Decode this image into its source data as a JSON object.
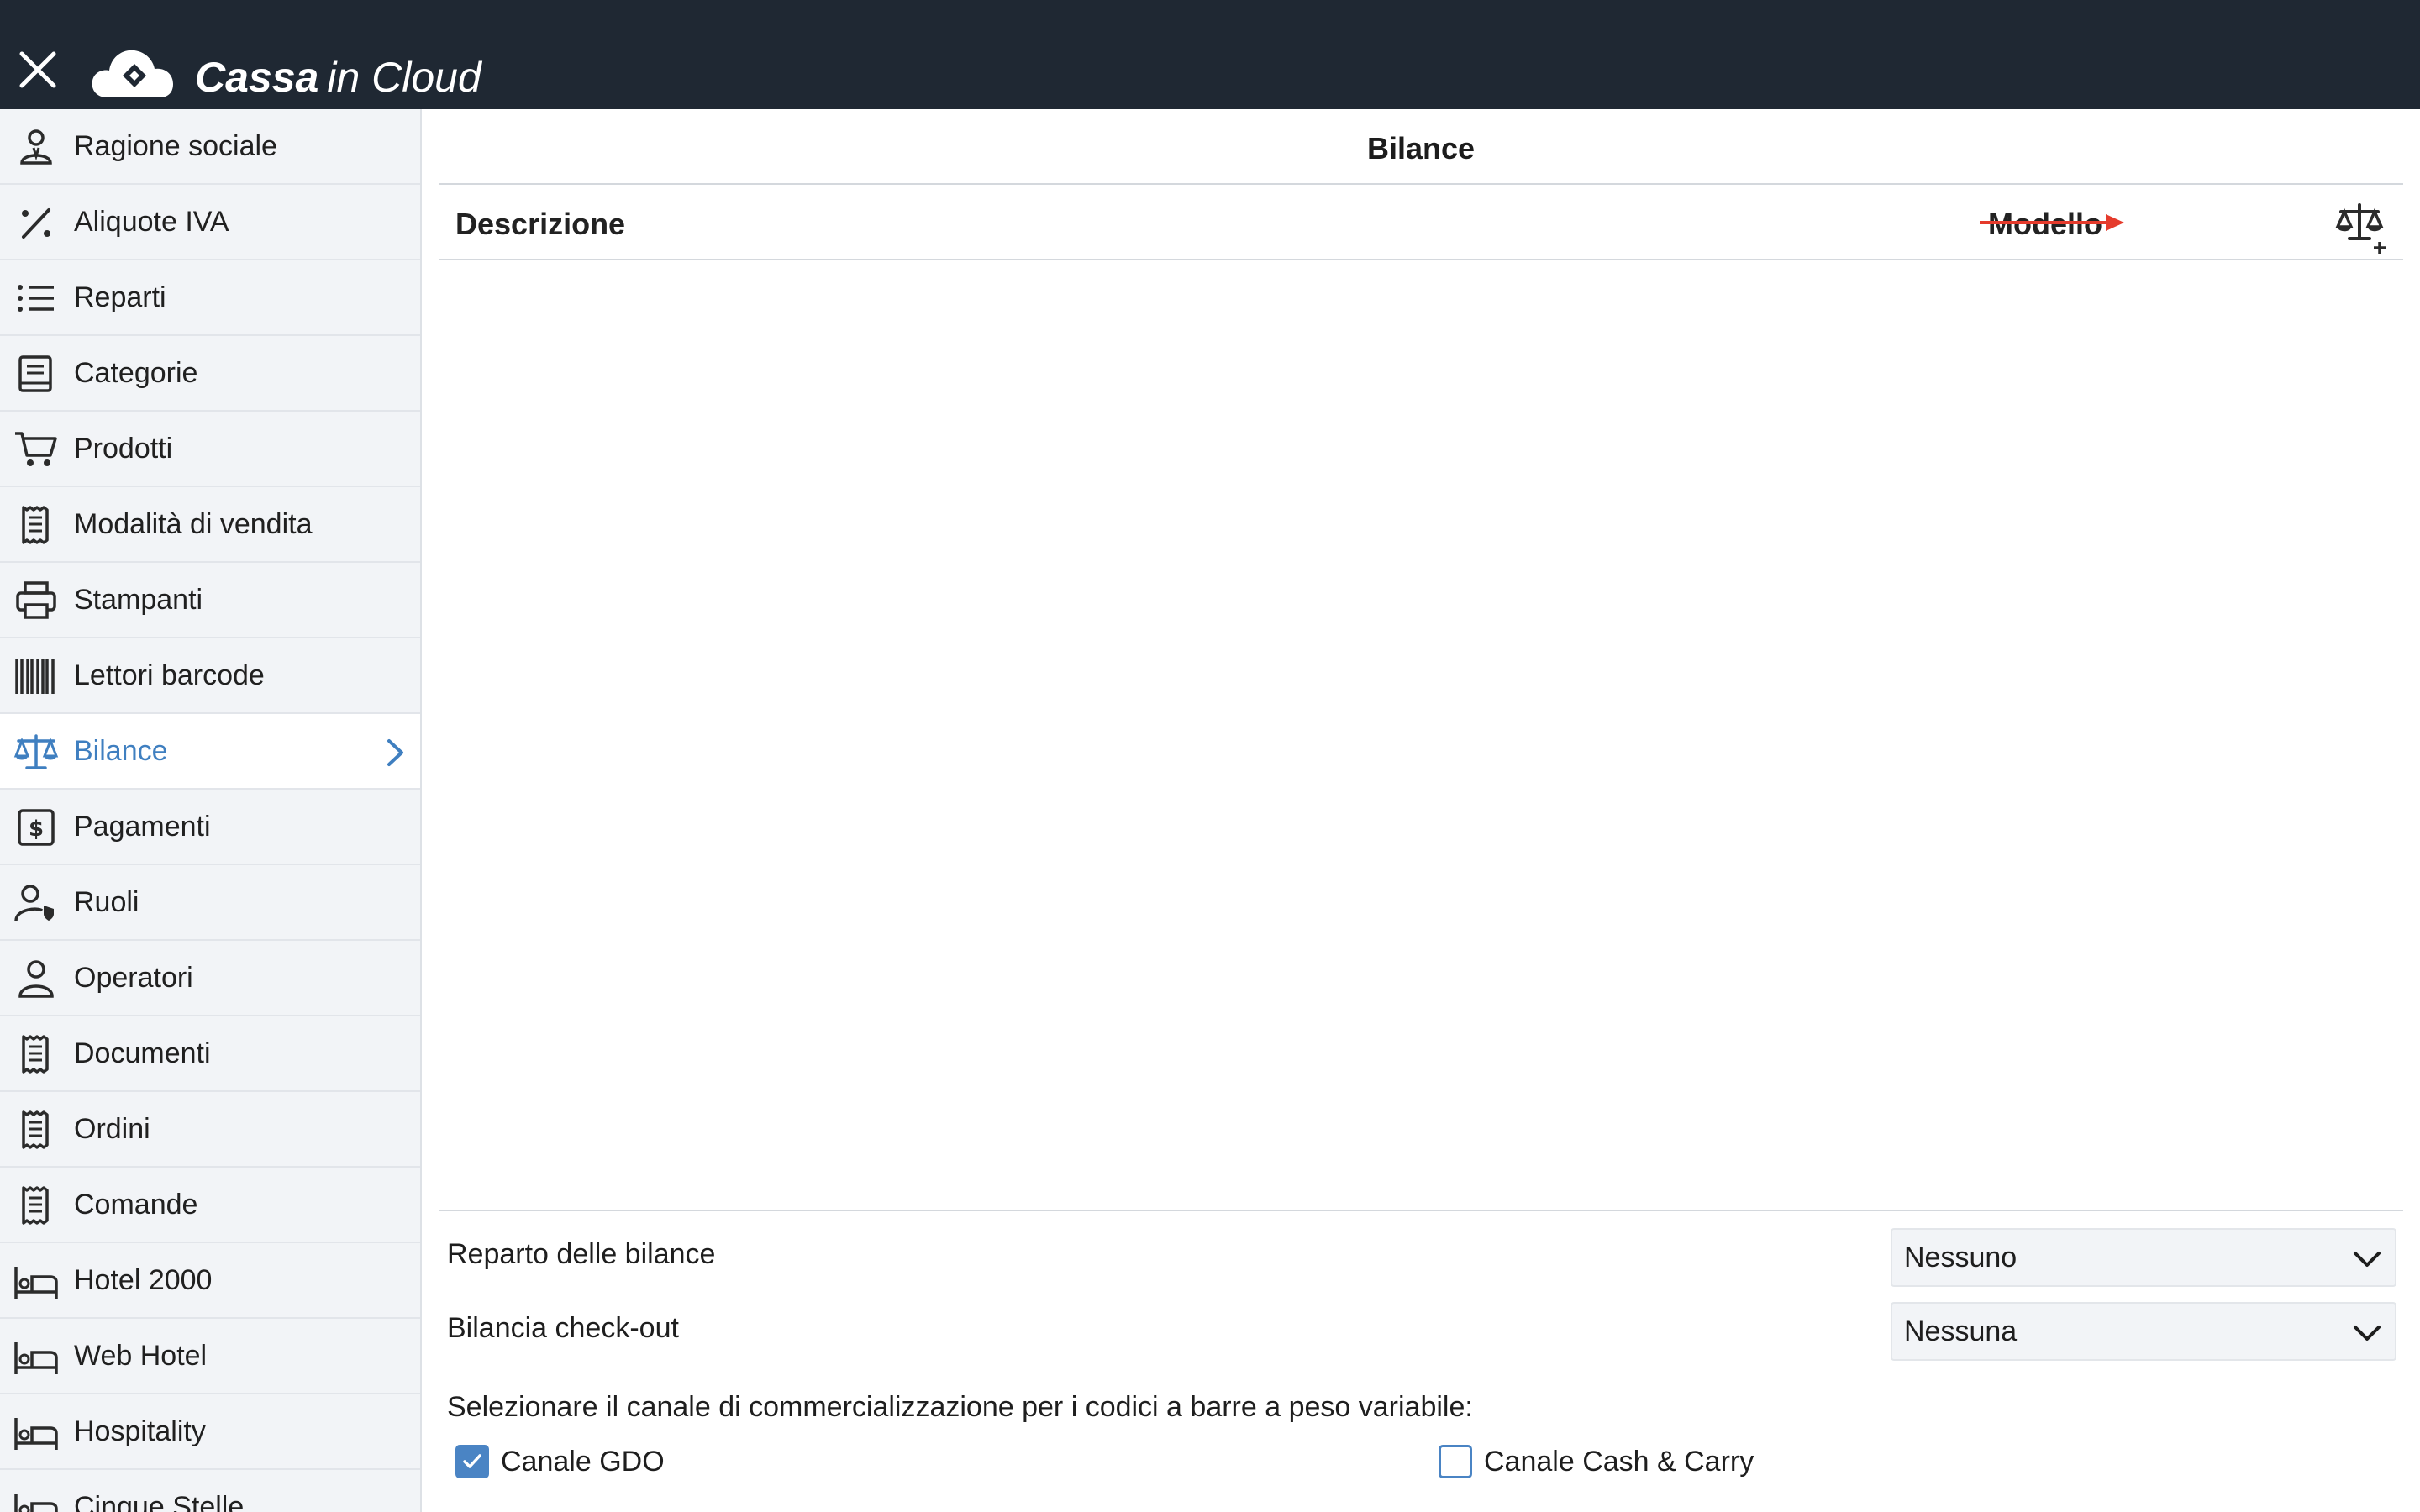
{
  "app": {
    "brand": "Cassa",
    "tagline": "in Cloud"
  },
  "sidebar": {
    "items": [
      {
        "label": "Ragione sociale",
        "icon": "company-user-icon"
      },
      {
        "label": "Aliquote IVA",
        "icon": "percent-icon"
      },
      {
        "label": "Reparti",
        "icon": "list-icon"
      },
      {
        "label": "Categorie",
        "icon": "book-icon"
      },
      {
        "label": "Prodotti",
        "icon": "cart-icon"
      },
      {
        "label": "Modalità di vendita",
        "icon": "receipt-icon"
      },
      {
        "label": "Stampanti",
        "icon": "printer-icon"
      },
      {
        "label": "Lettori barcode",
        "icon": "barcode-icon"
      },
      {
        "label": "Bilance",
        "icon": "scale-icon",
        "active": true
      },
      {
        "label": "Pagamenti",
        "icon": "dollar-icon"
      },
      {
        "label": "Ruoli",
        "icon": "user-shield-icon"
      },
      {
        "label": "Operatori",
        "icon": "user-icon"
      },
      {
        "label": "Documenti",
        "icon": "receipt-icon"
      },
      {
        "label": "Ordini",
        "icon": "receipt-icon"
      },
      {
        "label": "Comande",
        "icon": "receipt-icon"
      },
      {
        "label": "Hotel 2000",
        "icon": "bed-icon"
      },
      {
        "label": "Web Hotel",
        "icon": "bed-icon"
      },
      {
        "label": "Hospitality",
        "icon": "bed-icon"
      },
      {
        "label": "Cinque Stelle",
        "icon": "bed-icon"
      }
    ]
  },
  "main": {
    "title": "Bilance",
    "columns": {
      "description": "Descrizione",
      "model": "Modello"
    },
    "add_button_icon": "add-scale-icon",
    "settings": {
      "scale_department_label": "Reparto delle bilance",
      "scale_department_value": "Nessuno",
      "checkout_scale_label": "Bilancia check-out",
      "checkout_scale_value": "Nessuna",
      "channel_prompt": "Selezionare il canale di commercializzazione per i codici a barre a peso variabile:",
      "channel_gdo_label": "Canale GDO",
      "channel_gdo_checked": true,
      "channel_cash_carry_label": "Canale Cash & Carry",
      "channel_cash_carry_checked": false
    }
  },
  "colors": {
    "header_bg": "#1f2833",
    "accent": "#3f7fc0",
    "sidebar_bg": "#f2f4f7",
    "annotation_arrow": "#e53b2c"
  }
}
